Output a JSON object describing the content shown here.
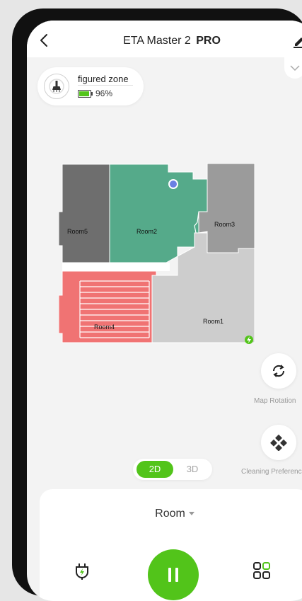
{
  "header": {
    "title": "ETA Master 2",
    "badge": "PRO"
  },
  "status": {
    "mode": "figured zone",
    "battery": "96%",
    "battery_level": 0.96
  },
  "map": {
    "rooms": [
      {
        "name": "Room5",
        "color": "#6e6e6e"
      },
      {
        "name": "Room2",
        "color": "#55aa8a"
      },
      {
        "name": "Room3",
        "color": "#9b9b9b"
      },
      {
        "name": "Room4",
        "color": "#f07373"
      },
      {
        "name": "Room1",
        "color": "#cdcdcd"
      }
    ]
  },
  "controls": {
    "map_rotation_label": "Map Rotation",
    "cleaning_preferences_label": "Cleaning Preferences",
    "view_toggle": {
      "options": [
        "2D",
        "3D"
      ],
      "selected": "2D"
    }
  },
  "bottom": {
    "mode": "Room"
  },
  "colors": {
    "accent": "#52c41a"
  }
}
